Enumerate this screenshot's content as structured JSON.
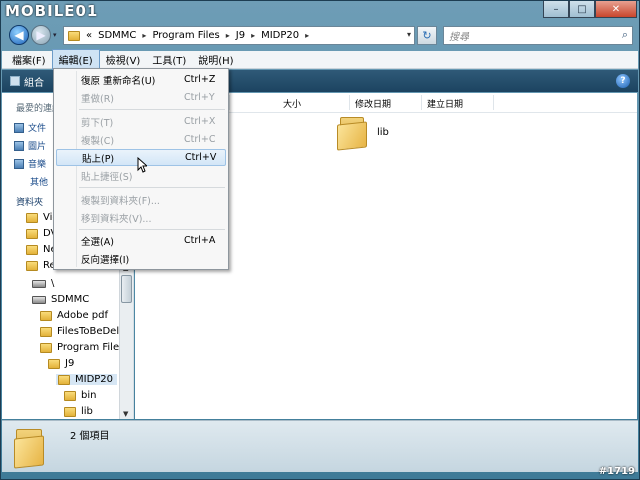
{
  "branding": {
    "logo": "MOBILE01",
    "watermark": "#1719"
  },
  "window": {
    "minimize": "–",
    "maximize": "□",
    "close": "✕"
  },
  "address": {
    "prefix": "«",
    "crumbs": [
      "SDMMC",
      "Program Files",
      "J9",
      "MIDP20"
    ],
    "separator": "▸",
    "dropdown": "▾",
    "refresh": "↻",
    "search_placeholder": "搜尋",
    "search_icon": "⌕"
  },
  "nav": {
    "back": "◀",
    "forward": "▶",
    "history": "▾"
  },
  "menubar": [
    {
      "label": "檔案(F)"
    },
    {
      "label": "編輯(E)",
      "active": true
    },
    {
      "label": "檢視(V)"
    },
    {
      "label": "工具(T)"
    },
    {
      "label": "說明(H)"
    }
  ],
  "toolbar": {
    "organize": "組合",
    "help": "?"
  },
  "sidebar": {
    "recent_header": "最愛的連結",
    "links": [
      "文件",
      "圖片",
      "音樂",
      "其他"
    ],
    "folders_header": "資料夾",
    "tree": [
      {
        "label": "Vid",
        "level": 0,
        "type": "folder"
      },
      {
        "label": "DV",
        "level": 0,
        "type": "folder"
      },
      {
        "label": "Ne",
        "level": 0,
        "type": "folder"
      },
      {
        "label": "Recycle Bin",
        "level": 0,
        "type": "folder"
      },
      {
        "label": "\\",
        "level": 1,
        "type": "drive"
      },
      {
        "label": "SDMMC",
        "level": 1,
        "type": "drive"
      },
      {
        "label": "Adobe pdf",
        "level": 2,
        "type": "folder"
      },
      {
        "label": "FilesToBeDele",
        "level": 2,
        "type": "folder"
      },
      {
        "label": "Program Files",
        "level": 2,
        "type": "folder"
      },
      {
        "label": "J9",
        "level": 3,
        "type": "folder"
      },
      {
        "label": "MIDP20",
        "level": 4,
        "type": "folder",
        "selected": true
      },
      {
        "label": "bin",
        "level": 5,
        "type": "folder"
      },
      {
        "label": "lib",
        "level": 5,
        "type": "folder"
      }
    ],
    "scroll_up": "▲",
    "scroll_down": "▼"
  },
  "columns": {
    "size": "大小",
    "modified": "修改日期",
    "created": "建立日期"
  },
  "files": [
    {
      "name": "lib"
    }
  ],
  "status": {
    "count": "2 個項目"
  },
  "edit_menu": {
    "items": [
      {
        "label": "復原 重新命名(U)",
        "key": "Ctrl+Z",
        "disabled": false
      },
      {
        "label": "重做(R)",
        "key": "Ctrl+Y",
        "disabled": true
      },
      {
        "sep": true
      },
      {
        "label": "剪下(T)",
        "key": "Ctrl+X",
        "disabled": true
      },
      {
        "label": "複製(C)",
        "key": "Ctrl+C",
        "disabled": true
      },
      {
        "label": "貼上(P)",
        "key": "Ctrl+V",
        "disabled": false,
        "hover": true
      },
      {
        "label": "貼上捷徑(S)",
        "key": "",
        "disabled": true
      },
      {
        "sep": true
      },
      {
        "label": "複製到資料夾(F)...",
        "key": "",
        "disabled": true
      },
      {
        "label": "移到資料夾(V)...",
        "key": "",
        "disabled": true
      },
      {
        "sep": true
      },
      {
        "label": "全選(A)",
        "key": "Ctrl+A",
        "disabled": false
      },
      {
        "label": "反向選擇(I)",
        "key": "",
        "disabled": false
      }
    ]
  }
}
